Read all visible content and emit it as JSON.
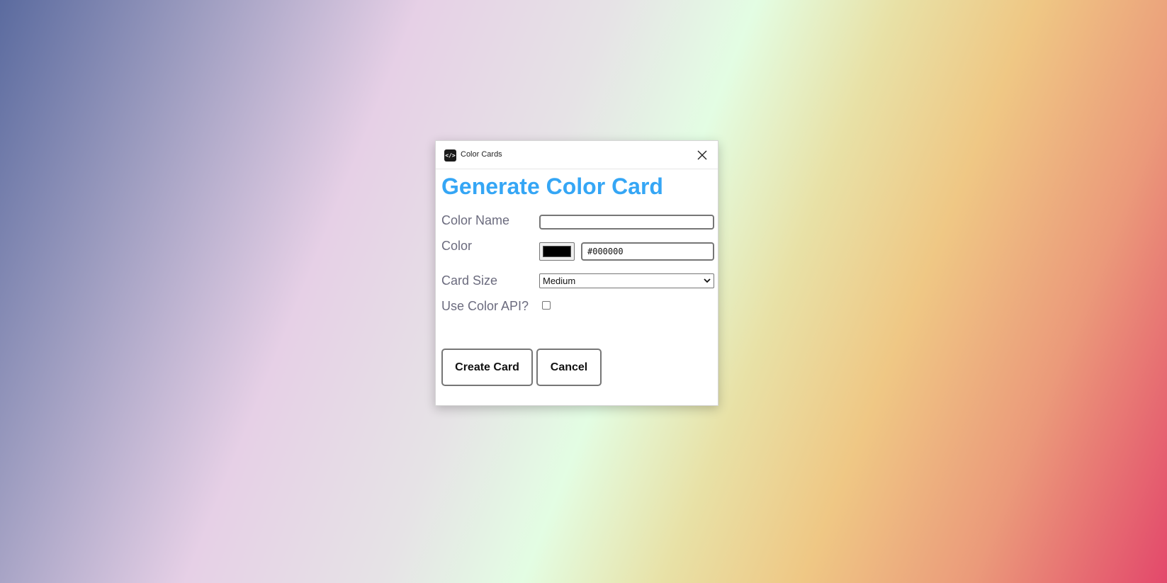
{
  "window": {
    "title": "Color Cards",
    "icon": "code-brackets-icon",
    "close_icon": "close-icon"
  },
  "form": {
    "heading": "Generate Color Card",
    "color_name": {
      "label": "Color Name",
      "value": "",
      "placeholder": ""
    },
    "color": {
      "label": "Color",
      "swatch_color": "#000000",
      "hex_value": "#000000"
    },
    "card_size": {
      "label": "Card Size",
      "selected": "Medium"
    },
    "use_api": {
      "label": "Use Color API?",
      "checked": false
    },
    "buttons": {
      "create": "Create Card",
      "cancel": "Cancel"
    }
  },
  "colors": {
    "heading": "#35a6f5",
    "label": "#6b6b7e"
  }
}
